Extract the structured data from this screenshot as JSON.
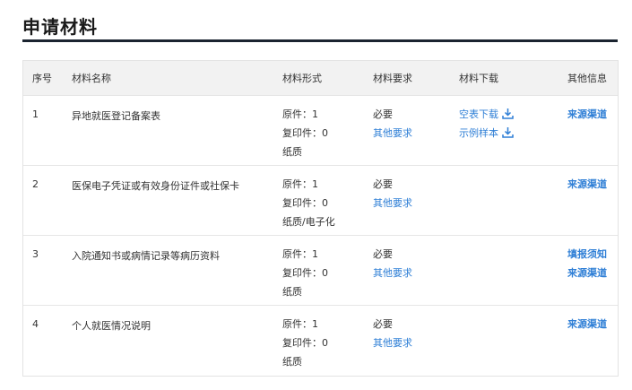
{
  "section": {
    "title": "申请材料"
  },
  "table": {
    "headers": {
      "no": "序号",
      "name": "材料名称",
      "form": "材料形式",
      "requirement": "材料要求",
      "download": "材料下载",
      "other": "其他信息"
    },
    "rows": [
      {
        "no": "1",
        "name": "异地就医登记备案表",
        "form": [
          "原件：1",
          "复印件：0",
          "纸质"
        ],
        "required": "必要",
        "other_req": "其他要求",
        "downloads": [
          "空表下载",
          "示例样本"
        ],
        "other": [
          "来源渠道"
        ]
      },
      {
        "no": "2",
        "name": "医保电子凭证或有效身份证件或社保卡",
        "form": [
          "原件：1",
          "复印件：0",
          "纸质/电子化"
        ],
        "required": "必要",
        "other_req": "其他要求",
        "downloads": [],
        "other": [
          "来源渠道"
        ]
      },
      {
        "no": "3",
        "name": "入院通知书或病情记录等病历资料",
        "form": [
          "原件：1",
          "复印件：0",
          "纸质"
        ],
        "required": "必要",
        "other_req": "其他要求",
        "downloads": [],
        "other": [
          "填报须知",
          "来源渠道"
        ]
      },
      {
        "no": "4",
        "name": "个人就医情况说明",
        "form": [
          "原件：1",
          "复印件：0",
          "纸质"
        ],
        "required": "必要",
        "other_req": "其他要求",
        "downloads": [],
        "other": [
          "来源渠道"
        ]
      }
    ]
  },
  "icons": {
    "download": "download-icon"
  },
  "colors": {
    "link": "#2f7fd6",
    "rule": "#1b2430",
    "header_bg": "#f2f2f2"
  }
}
